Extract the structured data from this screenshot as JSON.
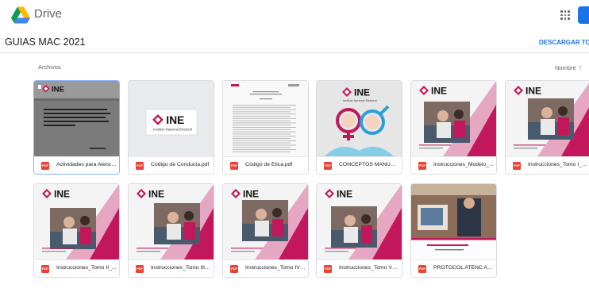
{
  "app": {
    "name": "Drive"
  },
  "folder": {
    "title": "GUIAS MAC 2021",
    "download_all": "DESCARGAR TODO"
  },
  "section": {
    "label": "Archivos"
  },
  "sort": {
    "label": "Nombre",
    "direction_icon": "↑"
  },
  "brand": {
    "logo_text": "INE",
    "logo_subtitle": "Instituto Nacional Electoral"
  },
  "files": [
    {
      "name": "Actividades para Atenci...",
      "type": "PDF",
      "icon": "pdf-icon",
      "selected": true,
      "thumbnail": "gray-document"
    },
    {
      "name": "Codigo de Conducta.pdf",
      "type": "PDF",
      "icon": "pdf-icon",
      "thumbnail": "ine-logo"
    },
    {
      "name": "Código de Ética.pdf",
      "type": "PDF",
      "icon": "pdf-icon",
      "thumbnail": "text-document"
    },
    {
      "name": "CONCEPTOS MANUAL ...",
      "type": "PDF",
      "icon": "pdf-icon",
      "thumbnail": "gender-symbols"
    },
    {
      "name": "Instrucciones_Modelo_...",
      "type": "PDF",
      "icon": "pdf-icon",
      "thumbnail": "ine-photo"
    },
    {
      "name": "Instrucciones_Tomo I_2...",
      "type": "PDF",
      "icon": "pdf-icon",
      "thumbnail": "ine-photo"
    },
    {
      "name": "Instrucciones_Tomo II_...",
      "type": "PDF",
      "icon": "pdf-icon",
      "thumbnail": "ine-photo"
    },
    {
      "name": "Instrucciones_Tomo III_...",
      "type": "PDF",
      "icon": "pdf-icon",
      "thumbnail": "ine-photo"
    },
    {
      "name": "Instrucciones_Tomo IV_...",
      "type": "PDF",
      "icon": "pdf-icon",
      "thumbnail": "ine-photo"
    },
    {
      "name": "Instrucciones_Tomo V_...",
      "type": "PDF",
      "icon": "pdf-icon",
      "thumbnail": "ine-photo"
    },
    {
      "name": "PROTOCOL ATENC AD...",
      "type": "PDF",
      "icon": "pdf-icon",
      "thumbnail": "protocol-photo"
    }
  ],
  "colors": {
    "accent": "#1a73e8",
    "pdf_red": "#ea4335",
    "ine_pink": "#c2185b",
    "selected_border": "#8ab4f8"
  }
}
